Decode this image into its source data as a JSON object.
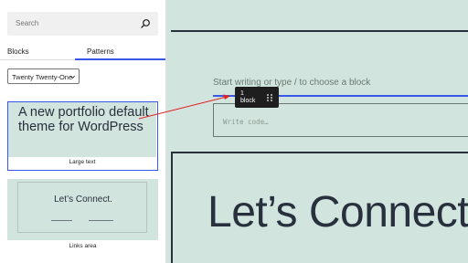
{
  "inserter": {
    "search": {
      "placeholder": "Search",
      "icon": "search-icon"
    },
    "tabs": [
      {
        "label": "Blocks",
        "selected": false
      },
      {
        "label": "Patterns",
        "selected": true
      }
    ],
    "category": {
      "selected": "Twenty Twenty-One"
    },
    "patterns": [
      {
        "preview_text": "A new portfolio default theme for WordPress",
        "label": "Large text",
        "selected": true
      },
      {
        "preview_text": "Let’s Connect.",
        "label": "Links area",
        "selected": false
      }
    ]
  },
  "editor": {
    "placeholder": "Start writing or type / to choose a block",
    "code_placeholder": "Write code…",
    "drag_chip": {
      "count": "1",
      "label": "block"
    },
    "heading": "Let’s Connect"
  },
  "colors": {
    "accent": "#3858e9",
    "canvas_background": "#d1e4dd",
    "text_dark": "#28303d",
    "annotation_arrow": "#e02424"
  }
}
